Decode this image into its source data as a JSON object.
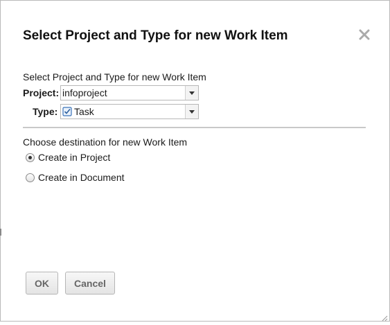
{
  "dialog": {
    "title": "Select Project and Type for new Work Item",
    "close_icon": "close-icon"
  },
  "form": {
    "subtitle": "Select Project and Type for new Work Item",
    "project_label": "Project:",
    "project_value": "infoproject",
    "type_label": "Type:",
    "type_value": "Task",
    "type_icon": "task-checkbox-icon",
    "dropdown_icon": "triangle-down-icon"
  },
  "destination": {
    "label": "Choose destination for new Work Item",
    "options": [
      {
        "label": "Create in Project",
        "checked": true
      },
      {
        "label": "Create in Document",
        "checked": false
      }
    ]
  },
  "buttons": {
    "ok": "OK",
    "cancel": "Cancel"
  },
  "colors": {
    "border": "#b9b9b9",
    "divider": "#c8c8c8",
    "button_text": "#666666",
    "task_icon": "#3b73b9"
  }
}
